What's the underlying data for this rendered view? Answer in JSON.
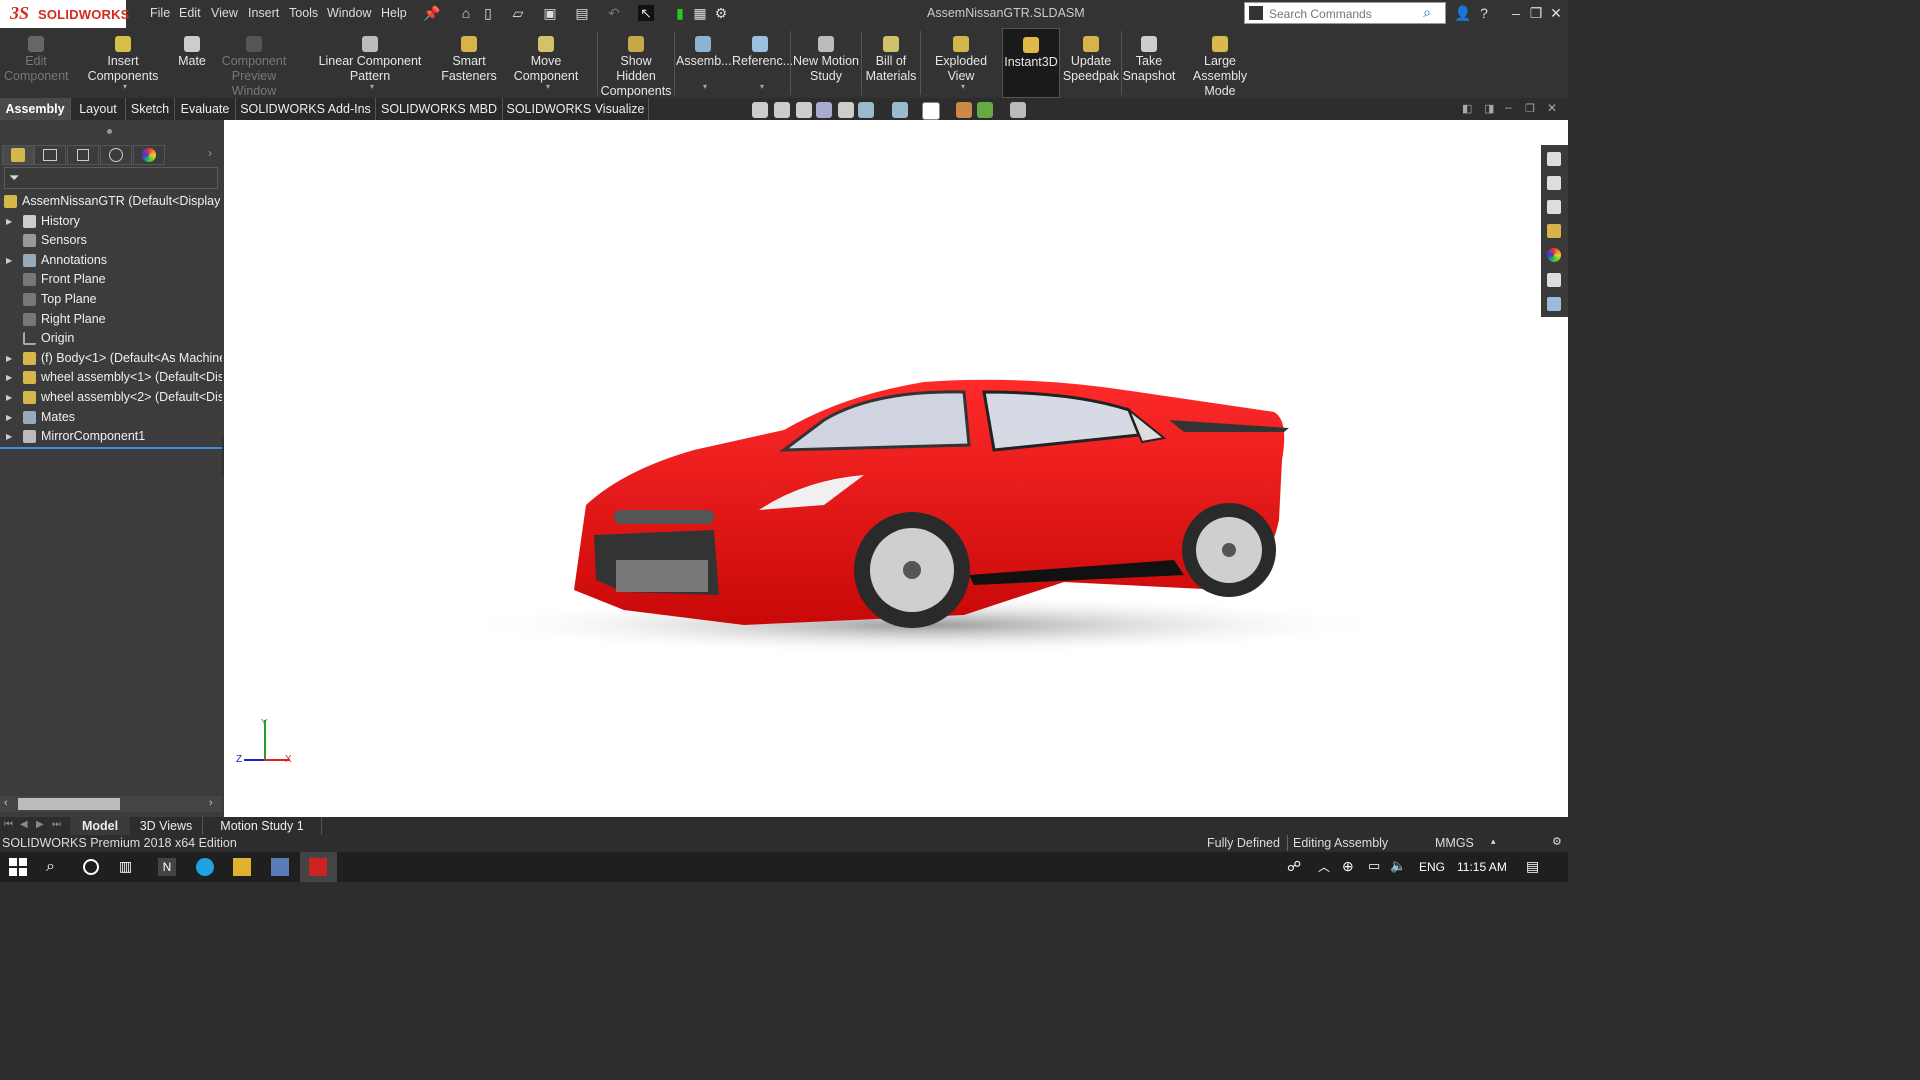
{
  "app": {
    "logo_ds": "3S",
    "logo_text": "SOLIDWORKS",
    "document_title": "AssemNissanGTR.SLDASM",
    "menus": [
      "File",
      "Edit",
      "View",
      "Insert",
      "Tools",
      "Window",
      "Help"
    ],
    "search_placeholder": "Search Commands",
    "quick_icons": [
      "pin-icon",
      "home-icon",
      "new-file-icon",
      "open-icon",
      "save-icon",
      "print-icon",
      "undo-icon",
      "select-icon",
      "traffic-light-icon",
      "file-properties-icon",
      "options-icon"
    ],
    "window_icons": [
      "user-icon",
      "help-icon",
      "minimize-icon",
      "restore-icon",
      "close-icon"
    ]
  },
  "commands": [
    {
      "label1": "Edit",
      "label2": "Component",
      "icon": "edit-component-icon",
      "disabled": true
    },
    {
      "label1": "Insert Components",
      "label2": "",
      "icon": "insert-components-icon",
      "disabled": false,
      "caret": true
    },
    {
      "label1": "Mate",
      "label2": "",
      "icon": "mate-icon",
      "disabled": false
    },
    {
      "label1": "Component",
      "label2": "Preview Window",
      "icon": "component-preview-icon",
      "disabled": true
    },
    {
      "label1": "Linear Component Pattern",
      "label2": "",
      "icon": "linear-pattern-icon",
      "disabled": false,
      "caret": true
    },
    {
      "label1": "Smart",
      "label2": "Fasteners",
      "icon": "smart-fasteners-icon",
      "disabled": false
    },
    {
      "label1": "Move Component",
      "label2": "",
      "icon": "move-component-icon",
      "disabled": false,
      "caret": true
    },
    {
      "label1": "Show Hidden",
      "label2": "Components",
      "icon": "show-hidden-icon",
      "disabled": false
    },
    {
      "label1": "Assemb...",
      "label2": "",
      "icon": "assembly-features-icon",
      "disabled": false,
      "caret": true
    },
    {
      "label1": "Referenc...",
      "label2": "",
      "icon": "reference-geometry-icon",
      "disabled": false,
      "caret": true
    },
    {
      "label1": "New Motion",
      "label2": "Study",
      "icon": "motion-study-icon",
      "disabled": false
    },
    {
      "label1": "Bill of",
      "label2": "Materials",
      "icon": "bom-icon",
      "disabled": false
    },
    {
      "label1": "Exploded View",
      "label2": "",
      "icon": "exploded-view-icon",
      "disabled": false,
      "caret": true
    },
    {
      "label1": "Instant3D",
      "label2": "",
      "icon": "instant3d-icon",
      "disabled": false,
      "active": true
    },
    {
      "label1": "Update",
      "label2": "Speedpak",
      "icon": "speedpak-icon",
      "disabled": false
    },
    {
      "label1": "Take",
      "label2": "Snapshot",
      "icon": "snapshot-icon",
      "disabled": false
    },
    {
      "label1": "Large Assembly",
      "label2": "Mode",
      "icon": "large-assembly-icon",
      "disabled": false
    }
  ],
  "tabs": [
    "Assembly",
    "Layout",
    "Sketch",
    "Evaluate",
    "SOLIDWORKS Add-Ins",
    "SOLIDWORKS MBD",
    "SOLIDWORKS Visualize"
  ],
  "active_tab": "Assembly",
  "tree": {
    "root": "AssemNissanGTR  (Default<Display S",
    "items": [
      {
        "label": "History",
        "icon": "history-icon",
        "expand": true
      },
      {
        "label": "Sensors",
        "icon": "sensors-icon",
        "expand": false
      },
      {
        "label": "Annotations",
        "icon": "annotations-icon",
        "expand": true
      },
      {
        "label": "Front Plane",
        "icon": "plane-icon",
        "expand": false
      },
      {
        "label": "Top Plane",
        "icon": "plane-icon",
        "expand": false
      },
      {
        "label": "Right Plane",
        "icon": "plane-icon",
        "expand": false
      },
      {
        "label": "Origin",
        "icon": "origin-icon",
        "expand": false
      },
      {
        "label": "(f) Body<1> (Default<As Machine",
        "icon": "part-icon",
        "expand": true
      },
      {
        "label": "wheel assembly<1> (Default<Dis",
        "icon": "subassembly-icon",
        "expand": true
      },
      {
        "label": "wheel assembly<2> (Default<Dis",
        "icon": "subassembly-icon",
        "expand": true
      },
      {
        "label": "Mates",
        "icon": "mates-icon",
        "expand": true
      },
      {
        "label": "MirrorComponent1",
        "icon": "mirror-component-icon",
        "expand": true
      }
    ]
  },
  "triad": {
    "y": "Y",
    "z": "Z",
    "x": "X"
  },
  "bottom_tabs": [
    "Model",
    "3D Views",
    "Motion Study 1"
  ],
  "status": {
    "edition": "SOLIDWORKS Premium 2018 x64 Edition",
    "defined": "Fully Defined",
    "mode": "Editing Assembly",
    "units": "MMGS"
  },
  "taskbar": {
    "lang": "ENG",
    "time": "11:15 AM"
  },
  "colors": {
    "car_red": "#e01010",
    "accent": "#d52b1e"
  }
}
